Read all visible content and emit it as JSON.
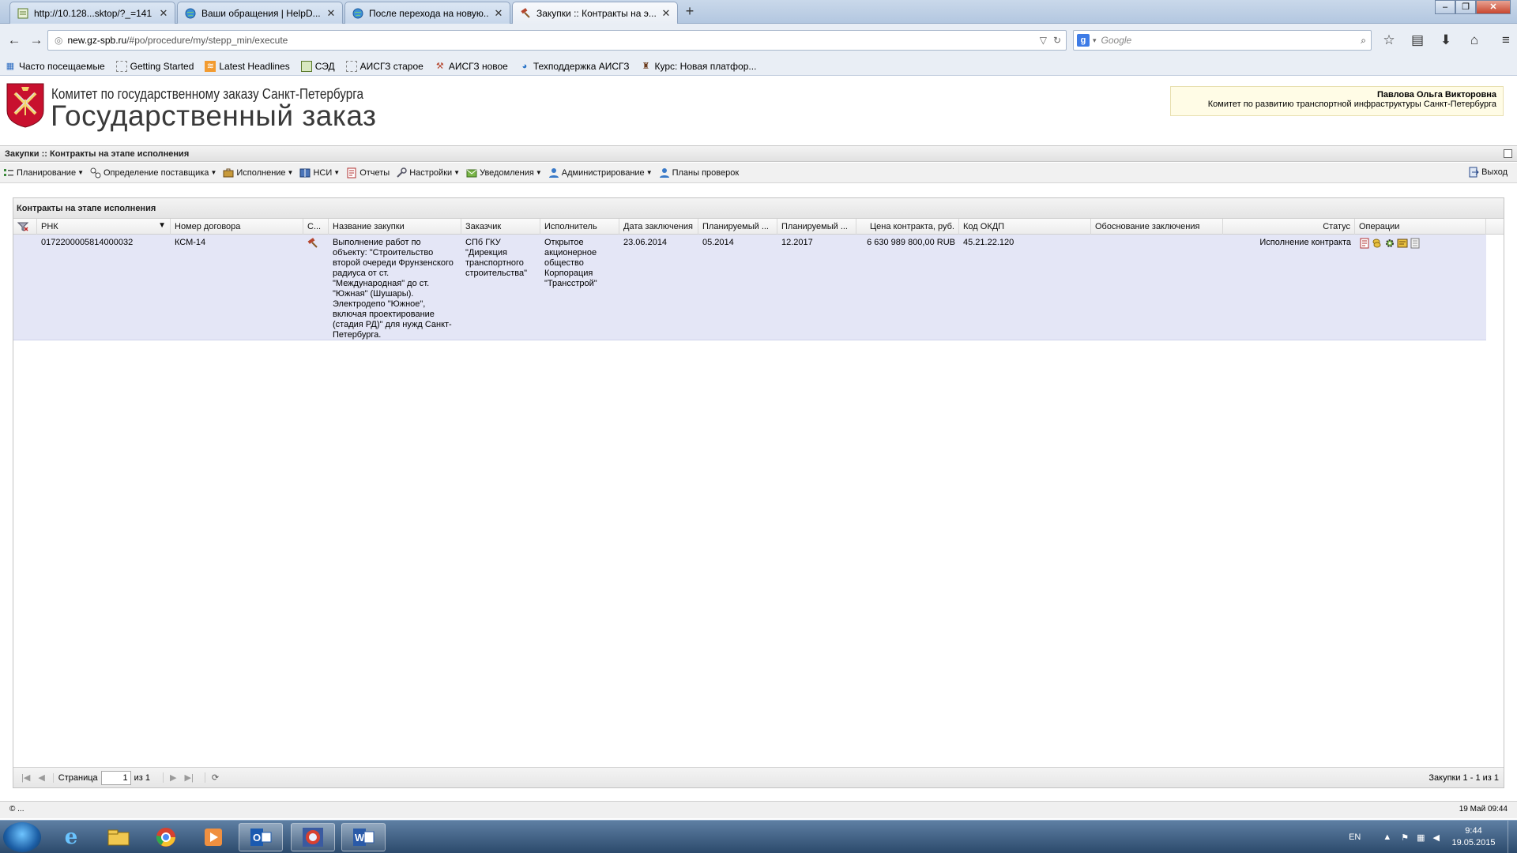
{
  "browser": {
    "tabs": [
      {
        "label": "http://10.128...sktop/?_=141",
        "icon": "page-icon"
      },
      {
        "label": "Ваши обращения | HelpD...",
        "icon": "globe-icon"
      },
      {
        "label": "После перехода на новую...",
        "icon": "globe-icon"
      },
      {
        "label": "Закупки :: Контракты на э...",
        "icon": "hammer-icon"
      }
    ],
    "url_host": "new.gz-spb.ru",
    "url_path": "/#po/procedure/my/stepp_min/execute",
    "search_placeholder": "Google",
    "bookmarks": [
      "Часто посещаемые",
      "Getting Started",
      "Latest Headlines",
      "СЭД",
      "АИСГЗ старое",
      "АИСГЗ новое",
      "Техподдержка АИСГЗ",
      "Курс: Новая платфор..."
    ]
  },
  "header": {
    "org_line1": "Комитет по государственному заказу Санкт-Петербурга",
    "org_line2": "Государственный заказ",
    "user_name": "Павлова Ольга Викторовна",
    "user_org": "Комитет по развитию транспортной инфраструктуры Санкт-Петербурга"
  },
  "app": {
    "title": "Закупки :: Контракты на этапе исполнения",
    "menu": [
      {
        "label": "Планирование",
        "dropdown": true
      },
      {
        "label": "Определение поставщика",
        "dropdown": true
      },
      {
        "label": "Исполнение",
        "dropdown": true
      },
      {
        "label": "НСИ",
        "dropdown": true
      },
      {
        "label": "Отчеты",
        "dropdown": false
      },
      {
        "label": "Настройки",
        "dropdown": true
      },
      {
        "label": "Уведомления",
        "dropdown": true
      },
      {
        "label": "Администрирование",
        "dropdown": true
      },
      {
        "label": "Планы проверок",
        "dropdown": false
      }
    ],
    "logout": "Выход"
  },
  "grid": {
    "title": "Контракты на этапе исполнения",
    "columns": [
      "РНК",
      "Номер договора",
      "С...",
      "Название закупки",
      "Заказчик",
      "Исполнитель",
      "Дата заключения",
      "Планируемый ...",
      "Планируемый ...",
      "Цена контракта, руб.",
      "Код ОКДП",
      "Обоснование заключения",
      "Статус",
      "Операции"
    ],
    "rows": [
      {
        "rnk": "0172200005814000032",
        "contract_number": "КСМ-14",
        "name": "Выполнение работ по объекту: \"Строительство второй очереди Фрунзенского радиуса от ст. \"Международная\" до ст. \"Южная\" (Шушары). Электродепо \"Южное\", включая проектирование (стадия РД)\" для нужд Санкт-Петербурга.",
        "customer": "СПб ГКУ \"Дирекция транспортного строительства\"",
        "executor": "Открытое акционерное общество Корпорация \"Трансстрой\"",
        "date_signed": "23.06.2014",
        "planned_start": "05.2014",
        "planned_end": "12.2017",
        "price": "6 630 989 800,00 RUB",
        "okdp": "45.21.22.120",
        "basis": "",
        "status": "Исполнение контракта"
      }
    ],
    "pager": {
      "page_label": "Страница",
      "page_value": "1",
      "of_label": "из 1",
      "summary": "Закупки 1 - 1 из 1"
    }
  },
  "status_bar": {
    "left": "© ...",
    "datetime": "19 Май 09:44"
  },
  "taskbar": {
    "lang": "EN",
    "time": "9:44",
    "date": "19.05.2015"
  }
}
